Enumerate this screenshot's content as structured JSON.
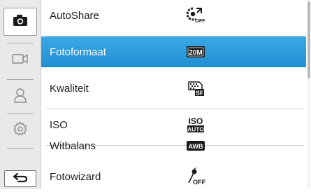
{
  "sidebar": {
    "modes": [
      {
        "icon": "camera-icon",
        "active": true
      },
      {
        "icon": "video-icon",
        "active": false
      },
      {
        "icon": "user-icon",
        "active": false
      },
      {
        "icon": "gear-icon",
        "active": false
      }
    ],
    "back_icon": "back-arrow-icon"
  },
  "menu": {
    "items": [
      {
        "label": "AutoShare",
        "icon": "autoshare-off-icon"
      },
      {
        "label": "Fotoformaat",
        "icon": "photo-size-20m-icon",
        "badge": "20M"
      },
      {
        "label": "Kwaliteit",
        "icon": "quality-superfine-icon",
        "badge": "SF"
      },
      {
        "label": "ISO",
        "icon": "iso-auto-icon",
        "badge": "ISO",
        "sub_badge": "AUTO"
      },
      {
        "label": "Witbalans",
        "icon": "white-balance-awb-icon",
        "badge": "AWB"
      },
      {
        "label": "Fotowizard",
        "icon": "photo-wizard-off-icon",
        "badge": "OFF"
      }
    ],
    "selected_index": 1
  },
  "colors": {
    "selection": "#1f8fd2",
    "sidebar_bg": "#e9e9e9"
  }
}
